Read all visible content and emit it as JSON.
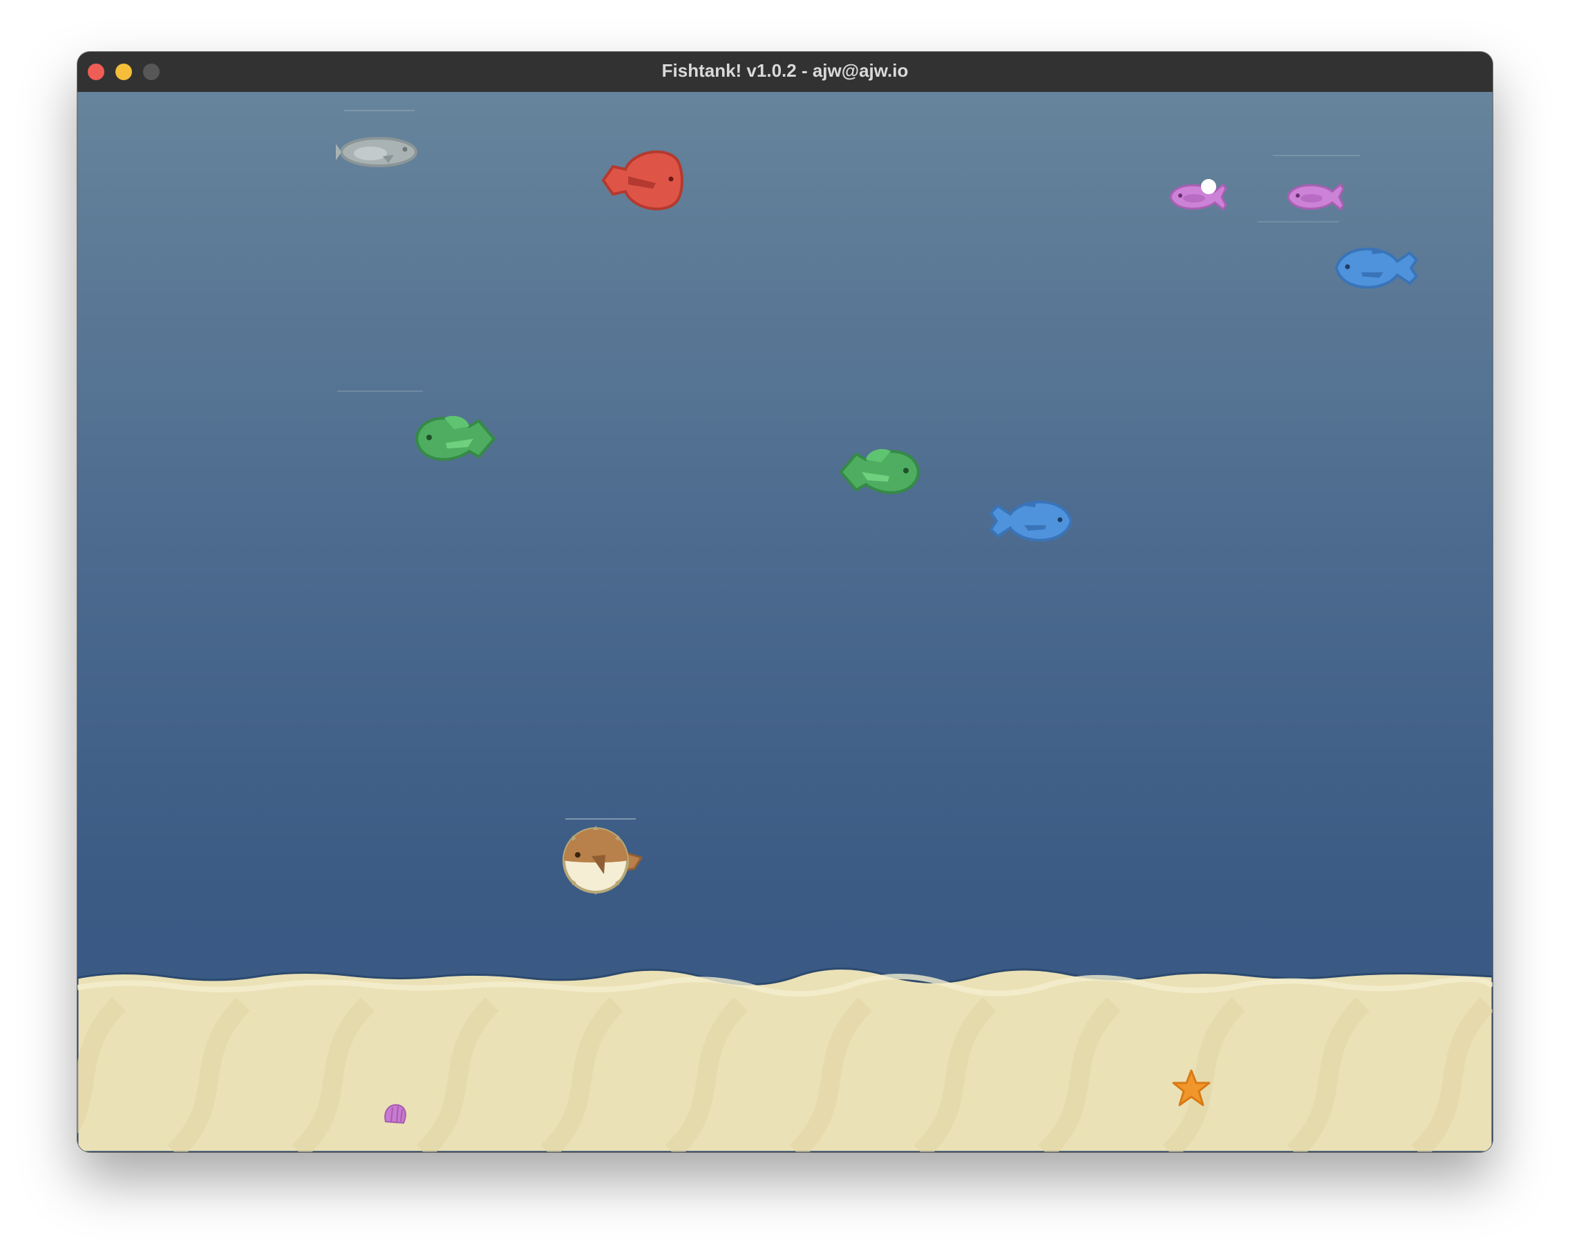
{
  "window": {
    "title": "Fishtank! v1.0.2 - ajw@ajw.io",
    "controls": [
      "close",
      "minimize",
      "maximize"
    ]
  },
  "scene": {
    "fish": [
      {
        "name": "gray-fish",
        "color": "#a9b3b4",
        "facing": "right"
      },
      {
        "name": "red-fish",
        "color": "#d9534a",
        "facing": "left"
      },
      {
        "name": "pink-fish-1",
        "color": "#c77ad0",
        "facing": "right"
      },
      {
        "name": "pink-fish-2",
        "color": "#c77ad0",
        "facing": "right"
      },
      {
        "name": "blue-fish-1",
        "color": "#4f8fd6",
        "facing": "left"
      },
      {
        "name": "green-fish-1",
        "color": "#4caf60",
        "facing": "left"
      },
      {
        "name": "green-fish-2",
        "color": "#4caf60",
        "facing": "right"
      },
      {
        "name": "blue-fish-2",
        "color": "#4f8fd6",
        "facing": "right"
      },
      {
        "name": "pufferfish",
        "color": "#b8804a",
        "facing": "right"
      }
    ],
    "decorations": [
      {
        "name": "seashell",
        "color": "#c77ad0"
      },
      {
        "name": "starfish",
        "color": "#f0962a"
      }
    ],
    "colors": {
      "water_top": "#66849b",
      "water_bottom": "#385884",
      "sand": "#ede3b9"
    }
  }
}
